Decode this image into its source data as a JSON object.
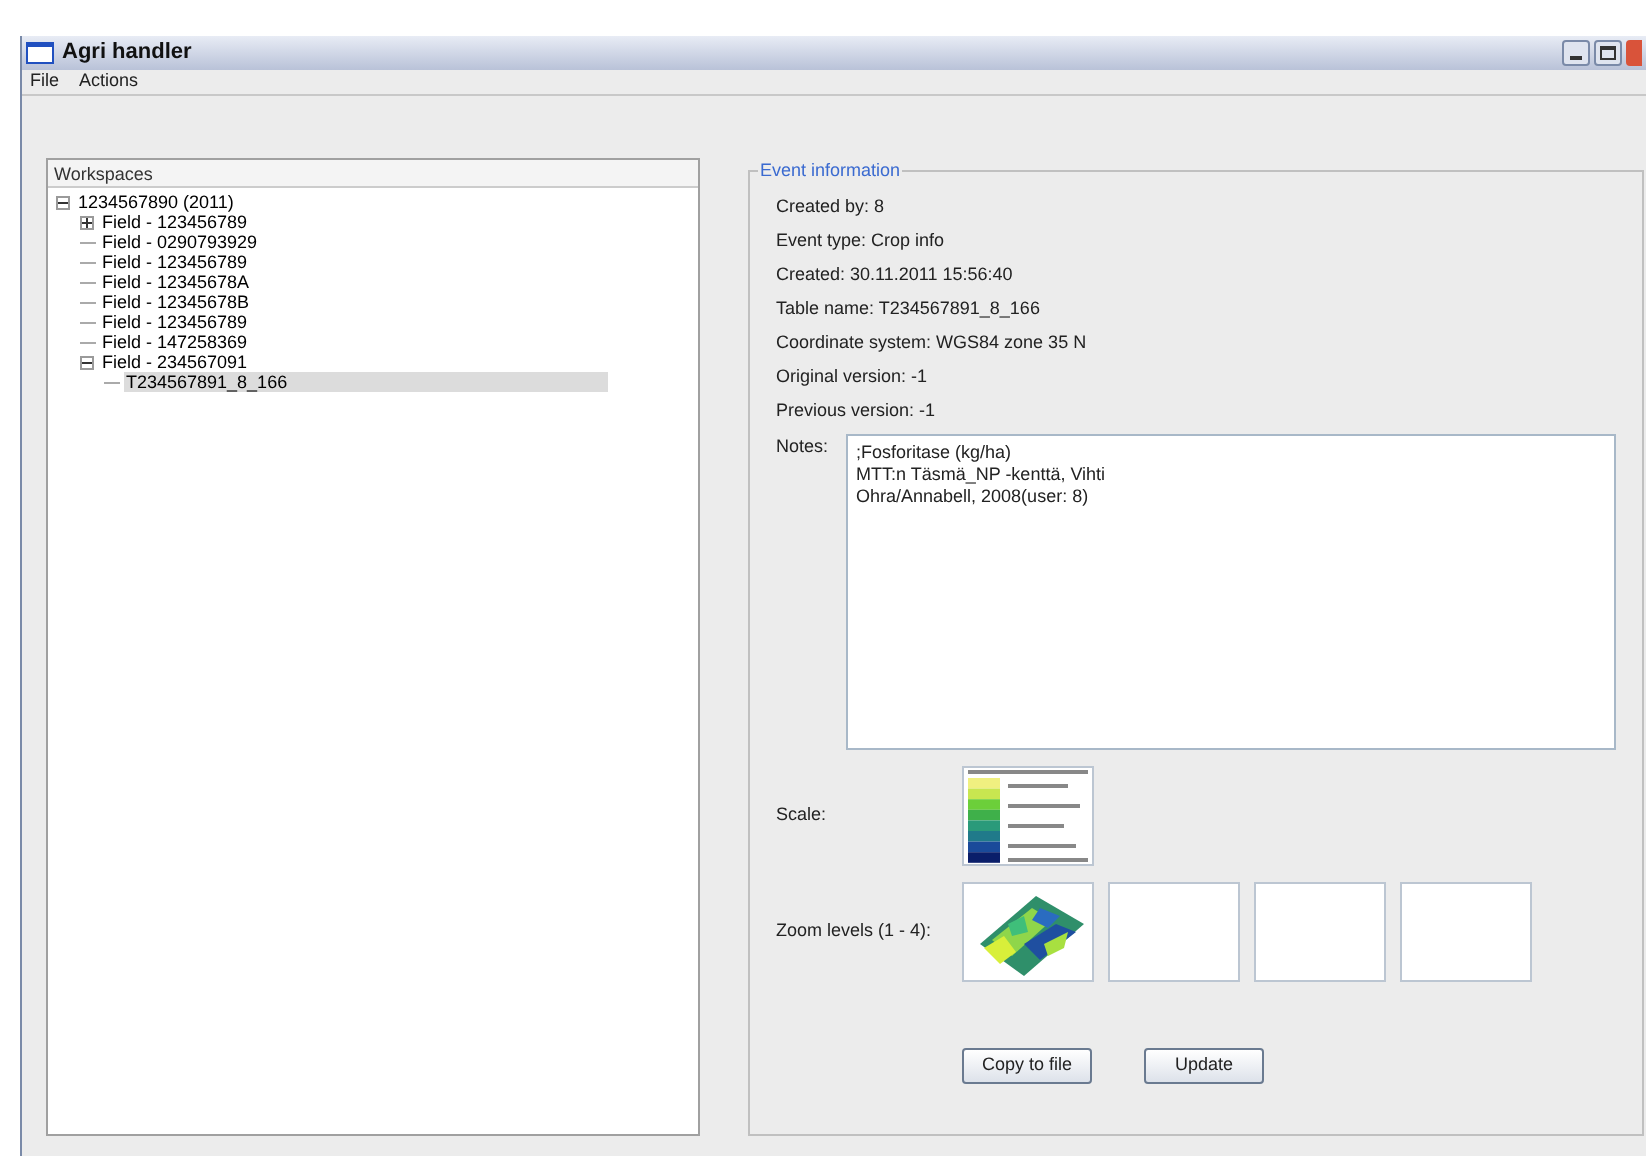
{
  "window": {
    "title": "Agri handler"
  },
  "menu": [
    "File",
    "Actions"
  ],
  "workspaces": {
    "header": "Workspaces",
    "tree": [
      {
        "label": "1234567890 (2011)",
        "expanded": true,
        "selected": false,
        "children": [
          {
            "label": "Field - 123456789",
            "expanded": false,
            "selected": false
          },
          {
            "label": "Field - 0290793929",
            "selected": false
          },
          {
            "label": "Field - 123456789",
            "selected": false
          },
          {
            "label": "Field - 12345678A",
            "selected": false
          },
          {
            "label": "Field - 12345678B",
            "selected": false
          },
          {
            "label": "Field - 123456789",
            "selected": false
          },
          {
            "label": "Field - 147258369",
            "selected": false
          },
          {
            "label": "Field - 234567091",
            "expanded": true,
            "selected": false,
            "children": [
              {
                "label": "T234567891_8_166",
                "selected": true
              }
            ]
          }
        ]
      }
    ]
  },
  "event_information": {
    "title": "Event information",
    "lines": [
      "Created by: 8",
      "Event type: Crop info",
      "Created: 30.11.2011 15:56:40",
      "Table name: T234567891_8_166",
      "Coordinate system: WGS84 zone 35 N",
      "Original version: -1",
      "Previous version: -1"
    ],
    "notes_label": "Notes:",
    "notes": [
      ";Fosforitase (kg/ha)",
      "MTT:n Täsmä_NP -kenttä, Vihti",
      "Ohra/Annabell, 2008(user: 8)"
    ],
    "scale_label": "Scale:",
    "zoom_label": "Zoom levels (1 - 4):",
    "zoom_levels": [
      {
        "kind": "picture"
      },
      {
        "kind": "empty"
      },
      {
        "kind": "empty"
      },
      {
        "kind": "empty"
      }
    ],
    "buttons": [
      "Copy to file",
      "Update"
    ]
  }
}
